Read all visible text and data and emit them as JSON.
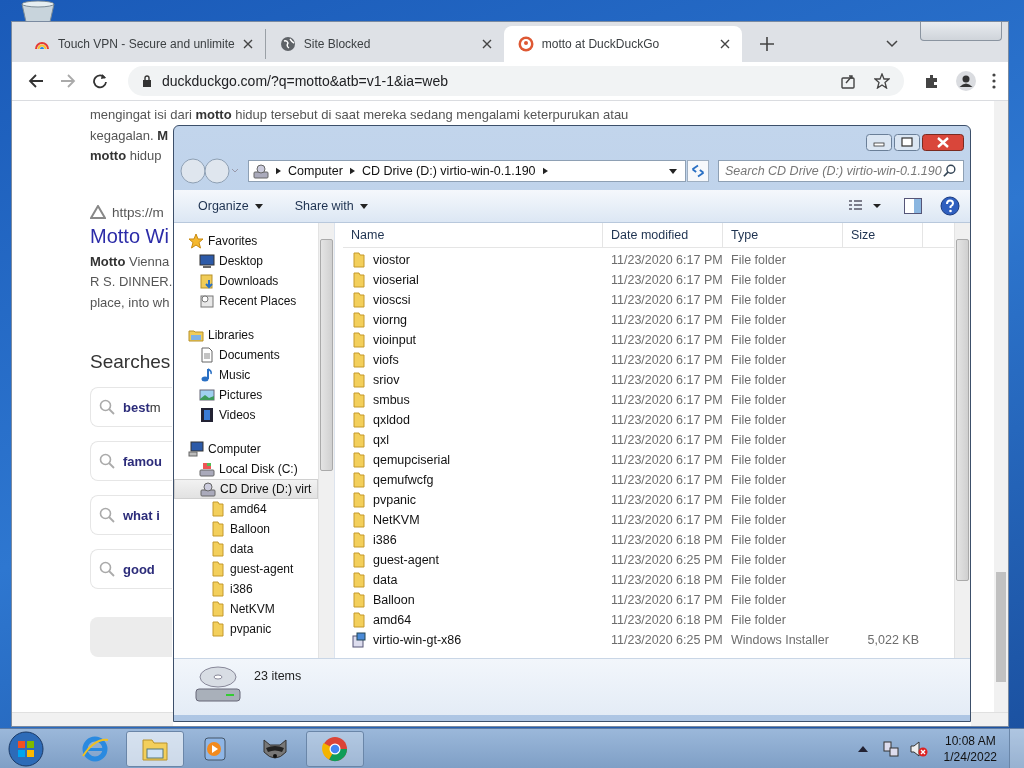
{
  "browser": {
    "tabs": [
      {
        "title": "Touch VPN - Secure and unlimite",
        "selected": false
      },
      {
        "title": "Site Blocked",
        "selected": false
      },
      {
        "title": "motto at DuckDuckGo",
        "selected": true
      }
    ],
    "address": "duckduckgo.com/?q=motto&atb=v1-1&ia=web",
    "page": {
      "paragraph": [
        "mengingat isi dari **motto** hidup tersebut di saat mereka sedang mengalami keterpurukan atau",
        "kegagalan. **M**",
        "**motto** hidup"
      ],
      "result": {
        "url": "https://m",
        "title": "Motto Wi",
        "snippet": [
          "**Motto** Vienna",
          "R S. DINNER.",
          "place, into wh"
        ]
      },
      "searches_heading": "Searches",
      "suggestions": [
        {
          "bold": "best",
          "rest": "m"
        },
        {
          "bold": "famou"
        },
        {
          "bold": "what i"
        },
        {
          "bold": "good"
        }
      ]
    }
  },
  "explorer": {
    "breadcrumb": [
      "Computer",
      "CD Drive (D:) virtio-win-0.1.190"
    ],
    "search_placeholder": "Search CD Drive (D:) virtio-win-0.1.190",
    "toolbar": [
      "Organize",
      "Share with"
    ],
    "nav": [
      {
        "label": "Favorites",
        "selected": false,
        "children": [
          {
            "label": "Desktop",
            "selected": false
          },
          {
            "label": "Downloads",
            "selected": false
          },
          {
            "label": "Recent Places",
            "selected": false
          }
        ]
      },
      {
        "label": "Libraries",
        "selected": false,
        "children": [
          {
            "label": "Documents",
            "selected": false
          },
          {
            "label": "Music",
            "selected": false
          },
          {
            "label": "Pictures",
            "selected": false
          },
          {
            "label": "Videos",
            "selected": false
          }
        ]
      },
      {
        "label": "Computer",
        "selected": false,
        "children": [
          {
            "label": "Local Disk (C:)",
            "selected": false
          },
          {
            "label": "CD Drive (D:) virt",
            "selected": true,
            "children": [
              {
                "label": "amd64",
                "selected": false
              },
              {
                "label": "Balloon",
                "selected": false
              },
              {
                "label": "data",
                "selected": false
              },
              {
                "label": "guest-agent",
                "selected": false
              },
              {
                "label": "i386",
                "selected": false
              },
              {
                "label": "NetKVM",
                "selected": false
              },
              {
                "label": "pvpanic",
                "selected": false
              }
            ]
          }
        ]
      }
    ],
    "columns": [
      "Name",
      "Date modified",
      "Type",
      "Size"
    ],
    "files": [
      {
        "name": "viostor",
        "modified": "11/23/2020 6:17 PM",
        "type": "File folder",
        "kind": "folder"
      },
      {
        "name": "vioserial",
        "modified": "11/23/2020 6:17 PM",
        "type": "File folder",
        "kind": "folder"
      },
      {
        "name": "vioscsi",
        "modified": "11/23/2020 6:17 PM",
        "type": "File folder",
        "kind": "folder"
      },
      {
        "name": "viorng",
        "modified": "11/23/2020 6:17 PM",
        "type": "File folder",
        "kind": "folder"
      },
      {
        "name": "vioinput",
        "modified": "11/23/2020 6:17 PM",
        "type": "File folder",
        "kind": "folder"
      },
      {
        "name": "viofs",
        "modified": "11/23/2020 6:17 PM",
        "type": "File folder",
        "kind": "folder"
      },
      {
        "name": "sriov",
        "modified": "11/23/2020 6:17 PM",
        "type": "File folder",
        "kind": "folder"
      },
      {
        "name": "smbus",
        "modified": "11/23/2020 6:17 PM",
        "type": "File folder",
        "kind": "folder"
      },
      {
        "name": "qxldod",
        "modified": "11/23/2020 6:17 PM",
        "type": "File folder",
        "kind": "folder"
      },
      {
        "name": "qxl",
        "modified": "11/23/2020 6:17 PM",
        "type": "File folder",
        "kind": "folder"
      },
      {
        "name": "qemupciserial",
        "modified": "11/23/2020 6:17 PM",
        "type": "File folder",
        "kind": "folder"
      },
      {
        "name": "qemufwcfg",
        "modified": "11/23/2020 6:17 PM",
        "type": "File folder",
        "kind": "folder"
      },
      {
        "name": "pvpanic",
        "modified": "11/23/2020 6:17 PM",
        "type": "File folder",
        "kind": "folder"
      },
      {
        "name": "NetKVM",
        "modified": "11/23/2020 6:17 PM",
        "type": "File folder",
        "kind": "folder"
      },
      {
        "name": "i386",
        "modified": "11/23/2020 6:18 PM",
        "type": "File folder",
        "kind": "folder"
      },
      {
        "name": "guest-agent",
        "modified": "11/23/2020 6:25 PM",
        "type": "File folder",
        "kind": "folder"
      },
      {
        "name": "data",
        "modified": "11/23/2020 6:18 PM",
        "type": "File folder",
        "kind": "folder"
      },
      {
        "name": "Balloon",
        "modified": "11/23/2020 6:17 PM",
        "type": "File folder",
        "kind": "folder"
      },
      {
        "name": "amd64",
        "modified": "11/23/2020 6:18 PM",
        "type": "File folder",
        "kind": "folder"
      },
      {
        "name": "virtio-win-gt-x86",
        "modified": "11/23/2020 6:25 PM",
        "type": "Windows Installer",
        "size": "5,022 KB",
        "kind": "installer"
      }
    ],
    "status": "23 items"
  },
  "taskbar": {
    "items": [
      {
        "open": false,
        "selected": false
      },
      {
        "open": true,
        "selected": true
      },
      {
        "open": false,
        "selected": false
      },
      {
        "open": false,
        "selected": false
      },
      {
        "open": true,
        "selected": false
      }
    ],
    "time": "10:08 AM",
    "date": "1/24/2022"
  }
}
